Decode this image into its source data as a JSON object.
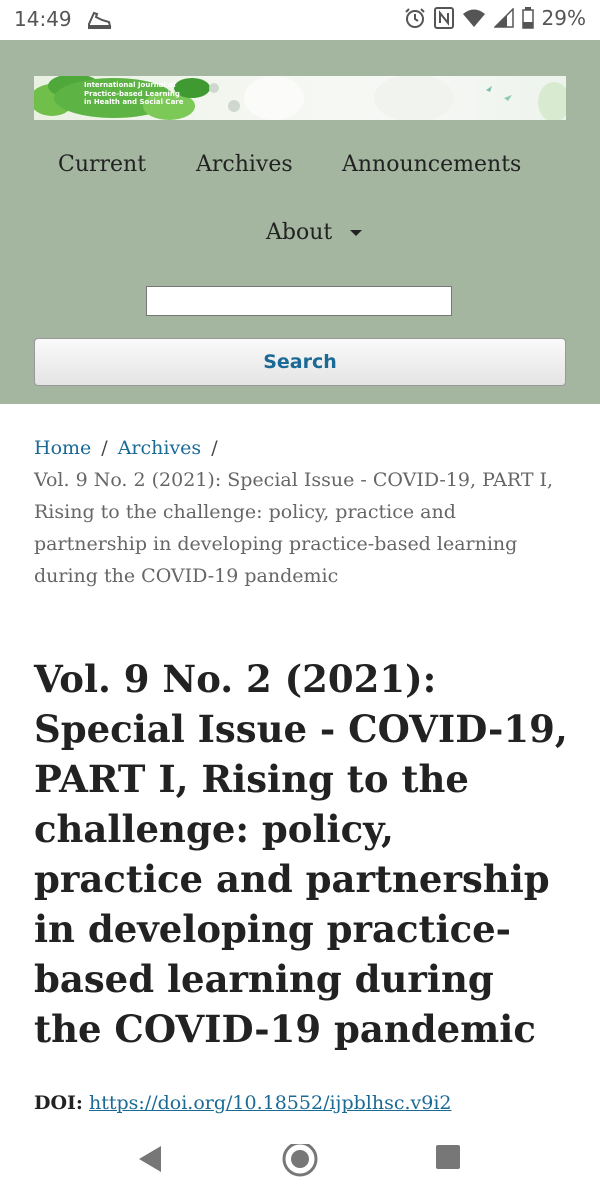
{
  "status_bar": {
    "time": "14:49",
    "battery": "29%",
    "icons": [
      "running-shoe-icon",
      "alarm-icon",
      "nfc-icon",
      "wifi-icon",
      "cellular-signal-icon",
      "battery-icon"
    ]
  },
  "header": {
    "journal_name_lines": [
      "International Journal of",
      "Practice-based Learning",
      "in Health and Social Care"
    ],
    "background_color": "#a4b5a0",
    "nav": {
      "current": "Current",
      "archives": "Archives",
      "announcements": "Announcements",
      "about": "About"
    },
    "search": {
      "value": "",
      "button_label": "Search"
    }
  },
  "breadcrumb": {
    "home": "Home",
    "archives": "Archives",
    "separator": "/",
    "current": "Vol. 9 No. 2 (2021): Special Issue - COVID-19, PART I, Rising to the challenge: policy, practice and partnership in developing practice-based learning during the COVID-19 pandemic"
  },
  "issue": {
    "title": "Vol. 9 No. 2 (2021): Special Issue - COVID-19, PART I, Rising to the challenge: policy, practice and partnership in developing practice-based learning during the COVID-19 pandemic",
    "doi_label": "DOI:",
    "doi_link": "https://doi.org/10.18552/ijpblhsc.v9i2"
  },
  "colors": {
    "link": "#1a6a95",
    "text": "#222222"
  }
}
